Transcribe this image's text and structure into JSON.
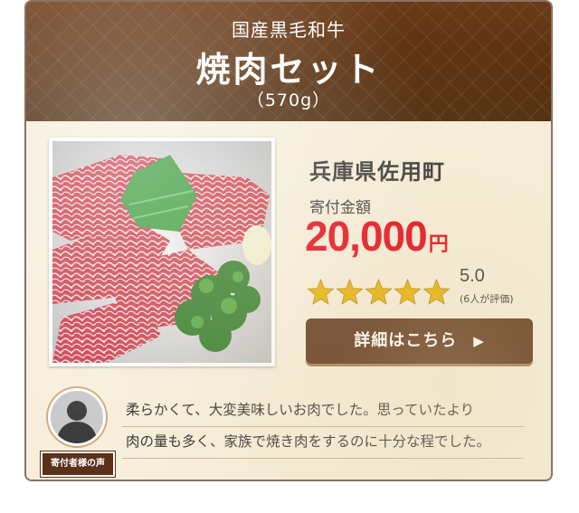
{
  "header": {
    "subtitle": "国産黒毛和牛",
    "title": "焼肉セット",
    "weight": "（570g）"
  },
  "product": {
    "image_alt": "焼肉セット",
    "town": "兵庫県佐用町",
    "donation_label": "寄付金額",
    "price": "20,000",
    "price_unit": "円",
    "rating": "5.0",
    "rating_value": 5,
    "rating_max": 5,
    "raters": "(6人が評価)",
    "detail_button": "詳細はこちら",
    "detail_arrow": "▶"
  },
  "voice": {
    "badge": "寄付者様の声",
    "lines": [
      "柔らかくて、大変美味しいお肉でした。思っていたより",
      "肉の量も多く、家族で焼き肉をするのに十分な程でした。"
    ]
  },
  "colors": {
    "header_bg": "#5a300f",
    "price": "#e60012",
    "button_bg": "#5b3117",
    "star": "#e5b100",
    "card_bg": "#f7efdc"
  },
  "icons": {
    "star": "star-icon",
    "arrow": "play-arrow-icon",
    "avatar": "person-silhouette-icon"
  }
}
